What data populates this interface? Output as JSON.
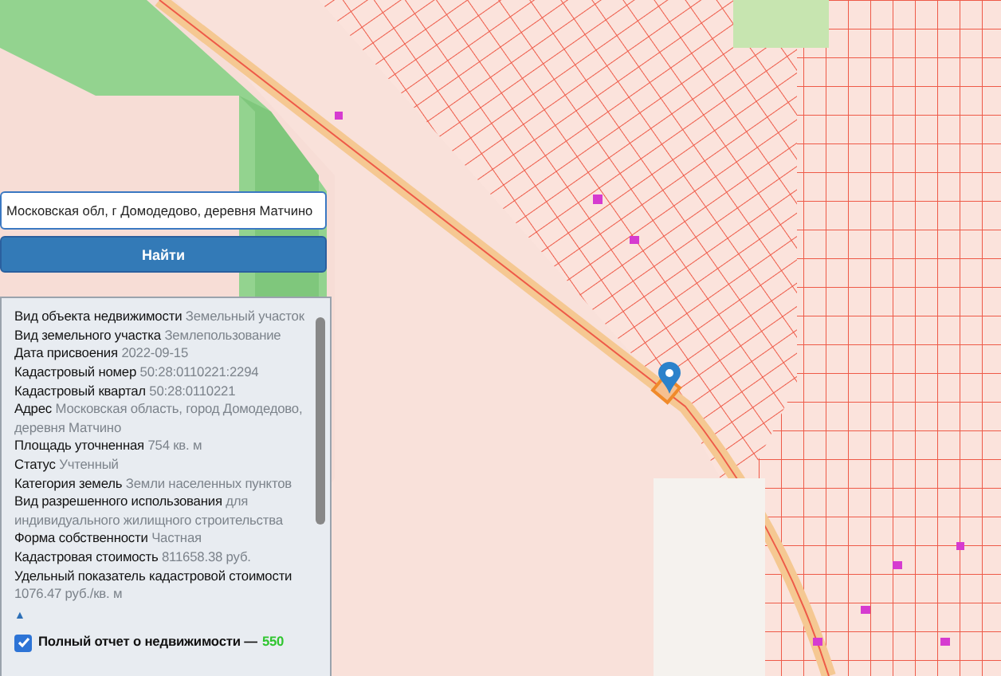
{
  "search": {
    "value": "Московская обл, г Домодедово, деревня Матчино"
  },
  "search_button": {
    "label": "Найти"
  },
  "info": {
    "fields": [
      {
        "label": "Вид объекта недвижимости",
        "value": "Земельный участок"
      },
      {
        "label": "Вид земельного участка",
        "value": "Землепользование"
      },
      {
        "label": "Дата присвоения",
        "value": "2022-09-15"
      },
      {
        "label": "Кадастровый номер",
        "value": "50:28:0110221:2294"
      },
      {
        "label": "Кадастровый квартал",
        "value": "50:28:0110221"
      },
      {
        "label": "Адрес",
        "value": "Московская область, город Домодедово, деревня Матчино"
      },
      {
        "label": "Площадь уточненная",
        "value": "754 кв. м"
      },
      {
        "label": "Статус",
        "value": "Учтенный"
      },
      {
        "label": "Категория земель",
        "value": "Земли населенных пунктов"
      },
      {
        "label": "Вид разрешенного использования",
        "value": "для индивидуального жилищного строительства"
      },
      {
        "label": "Форма собственности",
        "value": "Частная"
      },
      {
        "label": "Кадастровая стоимость",
        "value": "811658.38 руб."
      },
      {
        "label": "Удельный показатель кадастровой стоимости",
        "value": "1076.47 руб./кв. м"
      }
    ],
    "collapse": "▲",
    "report": {
      "checked": true,
      "label": "Полный отчет о недвижимости —",
      "price": "550"
    }
  }
}
